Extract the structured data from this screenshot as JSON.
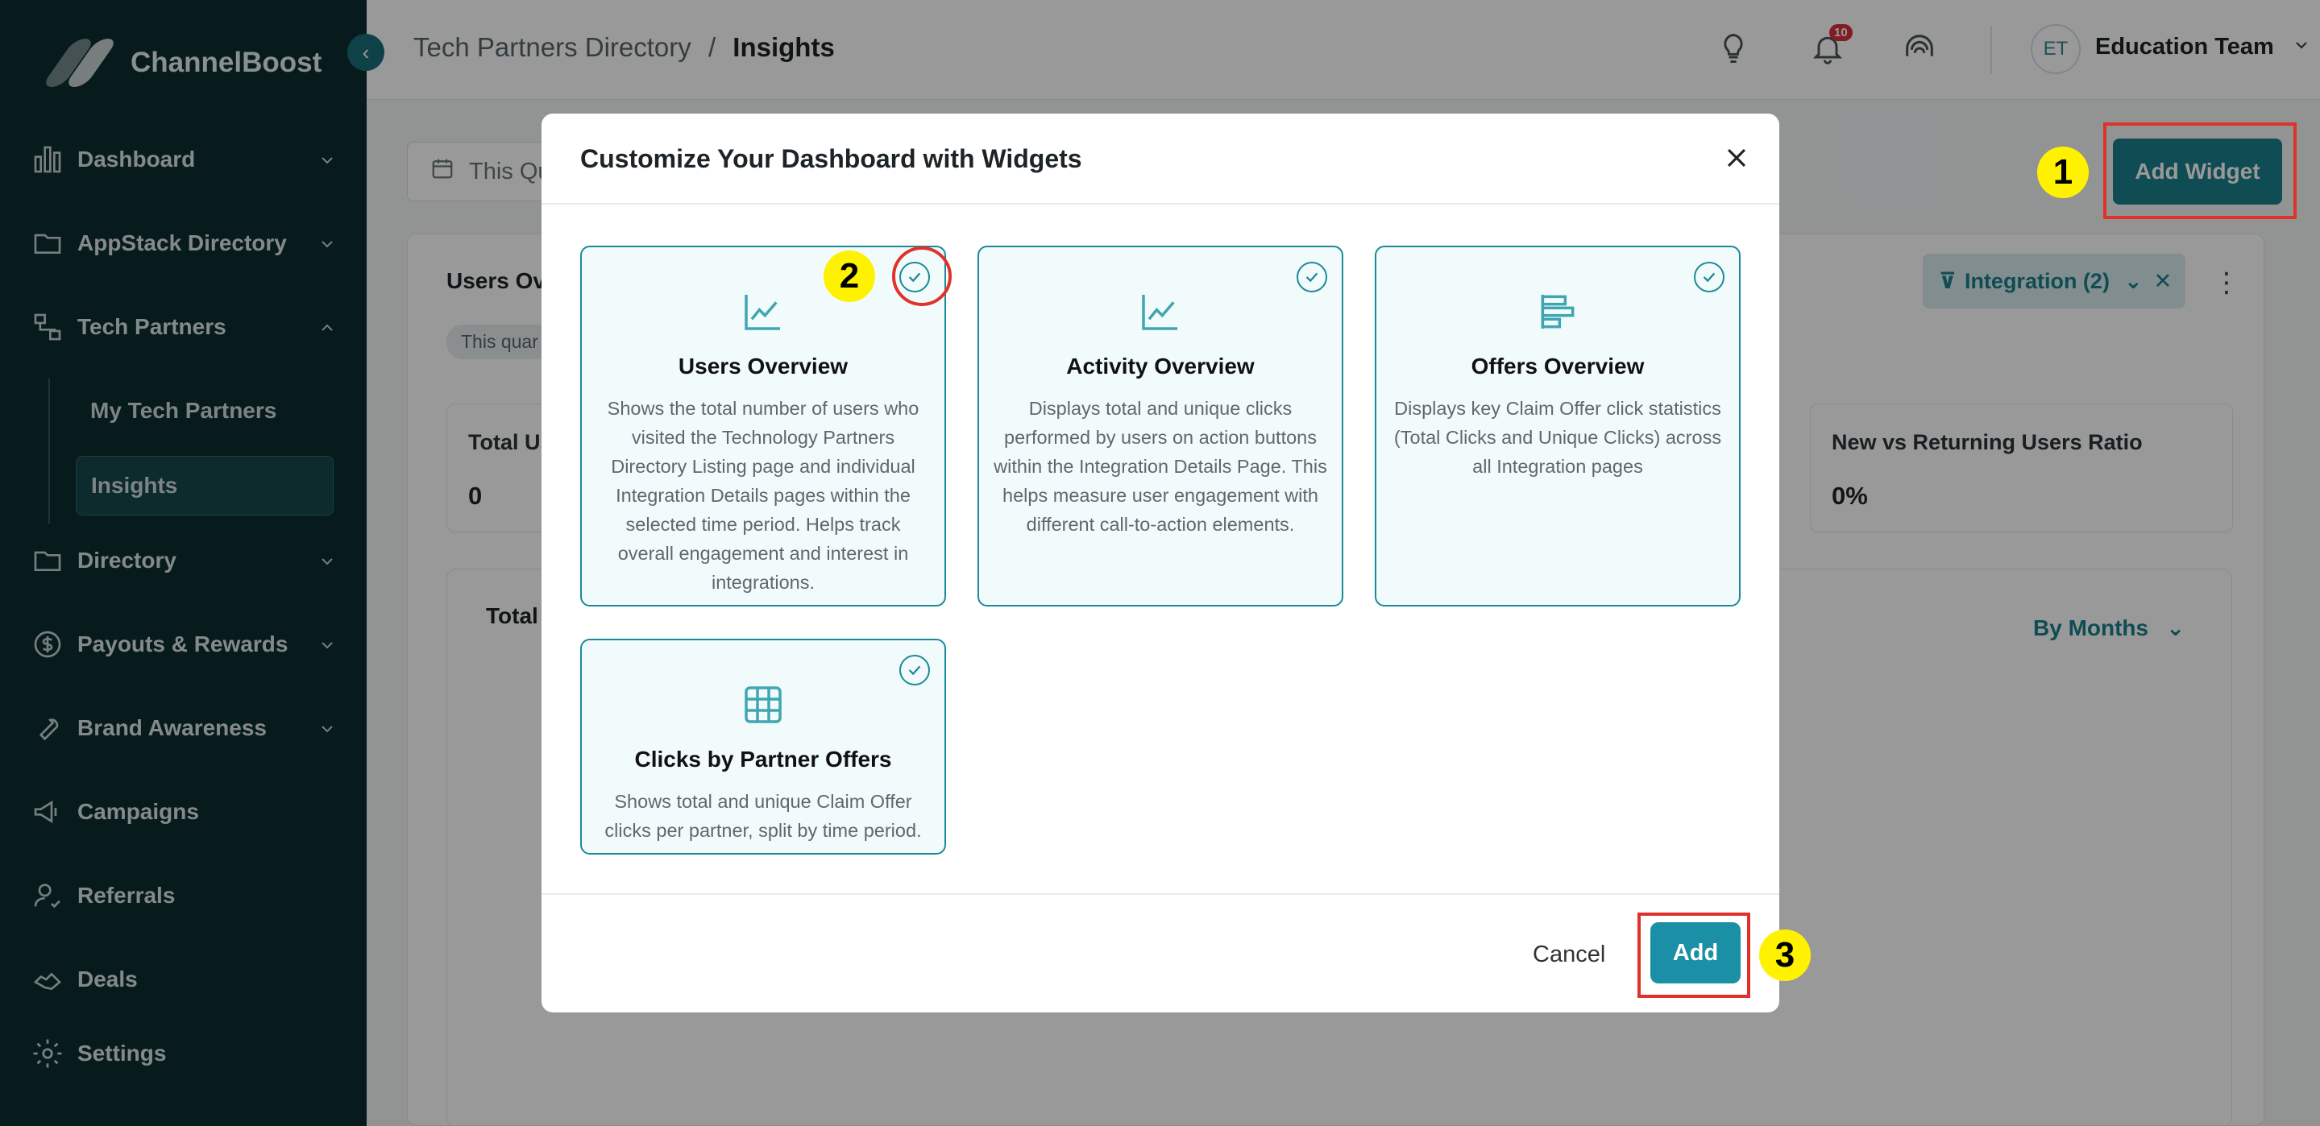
{
  "app": {
    "name": "ChannelBoost"
  },
  "sidebar": {
    "items": [
      {
        "label": "Dashboard",
        "icon": "bar-chart-icon"
      },
      {
        "label": "AppStack Directory",
        "icon": "folder-icon"
      },
      {
        "label": "Tech Partners",
        "icon": "network-icon"
      },
      {
        "label": "Directory",
        "icon": "folder-icon"
      },
      {
        "label": "Payouts & Rewards",
        "icon": "dollar-icon"
      },
      {
        "label": "Brand Awareness",
        "icon": "wrench-icon"
      },
      {
        "label": "Campaigns",
        "icon": "megaphone-icon"
      },
      {
        "label": "Referrals",
        "icon": "user-check-icon"
      },
      {
        "label": "Deals",
        "icon": "handshake-icon"
      },
      {
        "label": "Settings",
        "icon": "gear-icon"
      }
    ],
    "sub_items": [
      {
        "label": "My Tech Partners"
      },
      {
        "label": "Insights"
      }
    ]
  },
  "topbar": {
    "breadcrumb_parent": "Tech Partners Directory",
    "breadcrumb_sep": "/",
    "breadcrumb_current": "Insights",
    "notification_count": "10",
    "user_initials": "ET",
    "user_name": "Education Team"
  },
  "main": {
    "date_filter": "This Qu",
    "add_widget_label": "Add Widget",
    "panel_title": "Users Ove",
    "period_chip": "This quar",
    "integration_filter": "Integration (2)",
    "stat_cards": [
      {
        "label": "Total Us",
        "value": "0"
      },
      {
        "label": "New vs Returning Users Ratio",
        "value": "0%"
      }
    ],
    "chart_title": "Total",
    "group_by": "By Months"
  },
  "modal": {
    "title": "Customize Your Dashboard with Widgets",
    "widgets": [
      {
        "name": "Users Overview",
        "description": "Shows the total number of users who visited the Technology Partners Directory Listing page and individual Integration Details pages within the selected time period. Helps track overall engagement and interest in integrations."
      },
      {
        "name": "Activity Overview",
        "description": "Displays total and unique clicks performed by users on action buttons within the Integration Details Page. This helps measure user engagement with different call-to-action elements."
      },
      {
        "name": "Offers Overview",
        "description": "Displays key Claim Offer click statistics (Total Clicks and Unique Clicks) across all Integration pages"
      },
      {
        "name": "Clicks by Partner Offers",
        "description": "Shows total and unique Claim Offer clicks per partner, split by time period."
      }
    ],
    "cancel_label": "Cancel",
    "add_label": "Add"
  },
  "annotations": {
    "step1": "1",
    "step2": "2",
    "step3": "3"
  },
  "colors": {
    "accent": "#1b7f8b",
    "sidebar": "#0c2d31",
    "annotation_red": "#e0322b",
    "step_yellow": "#fff200"
  }
}
